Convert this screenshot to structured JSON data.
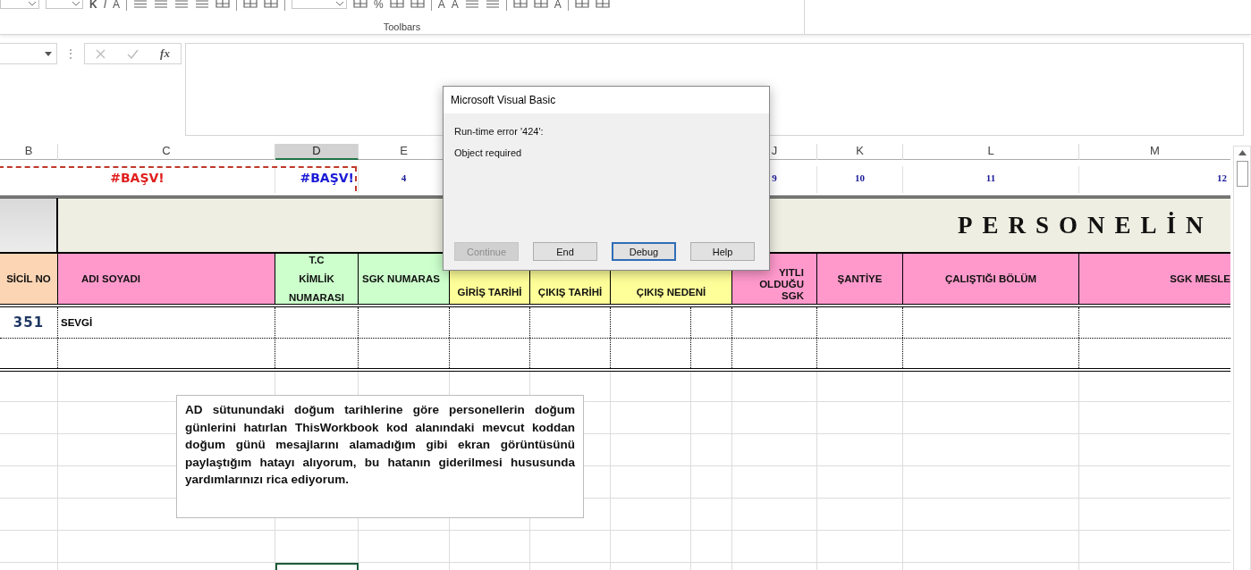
{
  "ribbon": {
    "items": [
      {
        "kind": "combo"
      },
      {
        "kind": "combo"
      },
      {
        "kind": "text",
        "text": "K"
      },
      {
        "kind": "text",
        "text": "I"
      },
      {
        "kind": "text",
        "text": "A"
      },
      {
        "kind": "sep"
      },
      {
        "kind": "lines"
      },
      {
        "kind": "lines"
      },
      {
        "kind": "lines"
      },
      {
        "kind": "lines"
      },
      {
        "kind": "box"
      },
      {
        "kind": "sep"
      },
      {
        "kind": "box"
      },
      {
        "kind": "box"
      },
      {
        "kind": "sep"
      },
      {
        "kind": "combo"
      },
      {
        "kind": "box"
      },
      {
        "kind": "text",
        "text": "%"
      },
      {
        "kind": "box"
      },
      {
        "kind": "box"
      },
      {
        "kind": "sep"
      },
      {
        "kind": "text",
        "text": "A"
      },
      {
        "kind": "text",
        "text": "A"
      },
      {
        "kind": "lines"
      },
      {
        "kind": "lines"
      },
      {
        "kind": "sep"
      },
      {
        "kind": "box"
      },
      {
        "kind": "box"
      },
      {
        "kind": "text",
        "text": "A"
      },
      {
        "kind": "sep"
      },
      {
        "kind": "box"
      },
      {
        "kind": "box"
      }
    ],
    "group_label": "Toolbars"
  },
  "formula_bar": {
    "more": "⋮",
    "function_label": "fx"
  },
  "columns": [
    {
      "letter": "B",
      "selected": false
    },
    {
      "letter": "C",
      "selected": false
    },
    {
      "letter": "D",
      "selected": true
    },
    {
      "letter": "E",
      "selected": false
    },
    {
      "letter": "J",
      "selected": false
    },
    {
      "letter": "K",
      "selected": false
    },
    {
      "letter": "L",
      "selected": false
    },
    {
      "letter": "M",
      "selected": false
    }
  ],
  "index_row": [
    {
      "text": "#BAŞV!",
      "color": "#e01e1e"
    },
    {
      "text": "#BAŞV!",
      "color": "#1a1ad6"
    },
    {
      "text": "4"
    },
    {
      "text": "9"
    },
    {
      "text": "10"
    },
    {
      "text": "11"
    },
    {
      "text": "12"
    }
  ],
  "title": "PERSONELİN",
  "headers": [
    {
      "lines": [
        "SİCİL NO"
      ],
      "color": "#fcd5b4"
    },
    {
      "lines": [
        "ADI SOYADI"
      ],
      "color": "#ff99cc"
    },
    {
      "lines": [
        "T.C",
        "KİMLİK",
        "NUMARASI"
      ],
      "color": "#ccffcc"
    },
    {
      "lines": [
        "SGK NUMARAS"
      ],
      "color": "#ccffcc"
    },
    {
      "lines": [
        "GİRİŞ TARİHİ"
      ],
      "color": "#ffff99"
    },
    {
      "lines": [
        "ÇIKIŞ TARİHİ"
      ],
      "color": "#ffff99"
    },
    {
      "lines": [
        "ÇIKIŞ NEDENİ"
      ],
      "color": "#ffff99"
    },
    {
      "lines": [
        "YITLI",
        "OLDUĞU",
        "SGK"
      ],
      "color": "#ff99cc"
    },
    {
      "lines": [
        "ŞANTİYE"
      ],
      "color": "#ff99cc"
    },
    {
      "lines": [
        "ÇALIŞTIĞI BÖLÜM"
      ],
      "color": "#ff99cc"
    },
    {
      "lines": [
        "SGK MESLE"
      ],
      "color": "#ff99cc"
    }
  ],
  "rows": [
    {
      "sicil_no": "351",
      "name": "SEVGİ"
    }
  ],
  "note": "AD sütunundaki doğum tarihlerine göre personellerin doğum günlerini hatırlan ThisWorkbook kod alanındaki mevcut koddan doğum günü mesajlarını alamadığım gibi ekran görüntüsünü paylaştığım hatayı alıyorum, bu hatanın giderilmesi hususunda yardımlarınızı rica ediyorum.",
  "dialog": {
    "title": "Microsoft Visual Basic",
    "messages": [
      "Run-time error '424':",
      "Object required"
    ],
    "buttons": [
      {
        "label": "Continue",
        "disabled": true,
        "focused": false
      },
      {
        "label": "End",
        "disabled": false,
        "focused": false
      },
      {
        "label": "Debug",
        "disabled": false,
        "focused": true
      },
      {
        "label": "Help",
        "disabled": false,
        "focused": false
      }
    ]
  }
}
